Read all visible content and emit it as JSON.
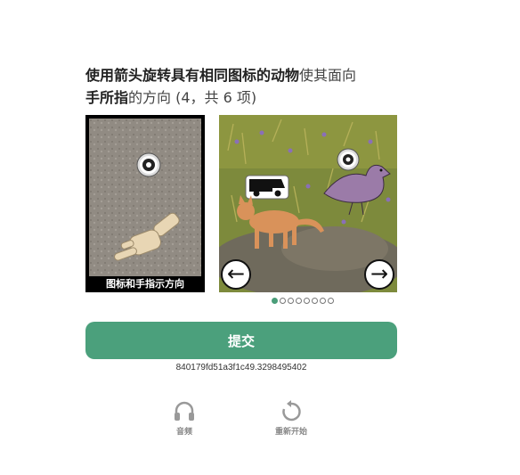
{
  "prompt": {
    "bold": "使用箭头旋转具有相同图标的动物",
    "rest": "使其面向",
    "bold2": "手所指",
    "tail": "的方向 (4，共 6 项)"
  },
  "reference": {
    "caption": "图标和手指示方向"
  },
  "scene": {
    "prev_label": "←",
    "next_label": "→"
  },
  "pagination": {
    "total": 8,
    "active": 0
  },
  "submit_label": "提交",
  "session_id": "840179fd51a3f1c49.3298495402",
  "tools": {
    "audio_label": "音频",
    "restart_label": "重新开始"
  },
  "colors": {
    "accent": "#4ba07c"
  }
}
